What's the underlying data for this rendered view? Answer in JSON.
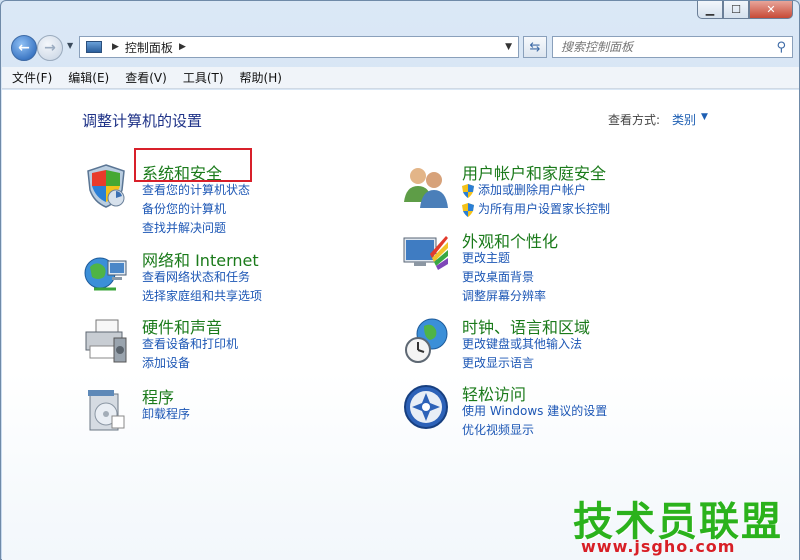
{
  "address": {
    "path": "控制面板"
  },
  "search": {
    "placeholder": "搜索控制面板"
  },
  "menu": [
    "文件(F)",
    "编辑(E)",
    "查看(V)",
    "工具(T)",
    "帮助(H)"
  ],
  "page": {
    "title": "调整计算机的设置",
    "view_mode_label": "查看方式:",
    "view_mode_value": "类别"
  },
  "categories": [
    {
      "title": "系统和安全",
      "links": [
        "查看您的计算机状态",
        "备份您的计算机",
        "查找并解决问题"
      ]
    },
    {
      "title": "网络和 Internet",
      "links": [
        "查看网络状态和任务",
        "选择家庭组和共享选项"
      ]
    },
    {
      "title": "硬件和声音",
      "links": [
        "查看设备和打印机",
        "添加设备"
      ]
    },
    {
      "title": "程序",
      "links": [
        "卸载程序"
      ]
    },
    {
      "title": "用户帐户和家庭安全",
      "links": [
        "添加或删除用户帐户",
        "为所有用户设置家长控制"
      ]
    },
    {
      "title": "外观和个性化",
      "links": [
        "更改主题",
        "更改桌面背景",
        "调整屏幕分辨率"
      ]
    },
    {
      "title": "时钟、语言和区域",
      "links": [
        "更改键盘或其他输入法",
        "更改显示语言"
      ]
    },
    {
      "title": "轻松访问",
      "links": [
        "使用 Windows 建议的设置",
        "优化视频显示"
      ]
    }
  ],
  "watermark": {
    "title": "技术员联盟",
    "url": "www.jsgho.com"
  }
}
